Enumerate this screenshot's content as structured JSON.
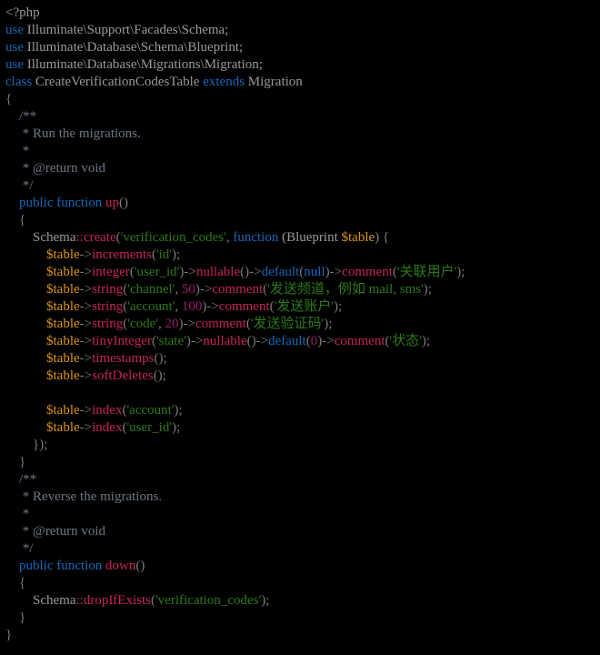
{
  "editor": {
    "title": "create_verification_codes_table.php",
    "language": "PHP",
    "background_color": "#000000",
    "font_size_px": 15,
    "line_height_px": 19
  },
  "theme": {
    "plain": "#9a9a9a",
    "keyword": "#1668b8",
    "type": "#9a9a9a",
    "method": "#c4245c",
    "string": "#2c7a18",
    "variable": "#e09512",
    "number": "#9b1a6e",
    "comment": "#6d7782",
    "punctuation": "#7a7a7a",
    "constant": "#1668b8"
  },
  "code": {
    "lines": [
      {
        "n": 1,
        "tokens": [
          {
            "t": "plain",
            "v": "<?php"
          }
        ]
      },
      {
        "n": 2,
        "tokens": [
          {
            "t": "keyword",
            "v": "use"
          },
          {
            "t": "plain",
            "v": " Illuminate\\Support\\Facades\\Schema;"
          }
        ]
      },
      {
        "n": 3,
        "tokens": [
          {
            "t": "keyword",
            "v": "use"
          },
          {
            "t": "plain",
            "v": " Illuminate\\Database\\Schema\\Blueprint;"
          }
        ]
      },
      {
        "n": 4,
        "tokens": [
          {
            "t": "keyword",
            "v": "use"
          },
          {
            "t": "plain",
            "v": " Illuminate\\Database\\Migrations\\Migration;"
          }
        ]
      },
      {
        "n": 5,
        "tokens": [
          {
            "t": "keyword",
            "v": "class"
          },
          {
            "t": "plain",
            "v": " CreateVerificationCodesTable "
          },
          {
            "t": "keyword",
            "v": "extends"
          },
          {
            "t": "plain",
            "v": " Migration"
          }
        ]
      },
      {
        "n": 6,
        "tokens": [
          {
            "t": "punct",
            "v": "{"
          }
        ]
      },
      {
        "n": 7,
        "tokens": [
          {
            "t": "comment",
            "v": "    /**"
          }
        ]
      },
      {
        "n": 8,
        "tokens": [
          {
            "t": "comment",
            "v": "     * Run the migrations."
          }
        ]
      },
      {
        "n": 9,
        "tokens": [
          {
            "t": "comment",
            "v": "     *"
          }
        ]
      },
      {
        "n": 10,
        "tokens": [
          {
            "t": "comment",
            "v": "     * @return void"
          }
        ]
      },
      {
        "n": 11,
        "tokens": [
          {
            "t": "comment",
            "v": "     */"
          }
        ]
      },
      {
        "n": 12,
        "tokens": [
          {
            "t": "plain",
            "v": "    "
          },
          {
            "t": "keyword",
            "v": "public function "
          },
          {
            "t": "method",
            "v": "up"
          },
          {
            "t": "punct",
            "v": "()"
          }
        ]
      },
      {
        "n": 13,
        "tokens": [
          {
            "t": "punct",
            "v": "    {"
          }
        ]
      },
      {
        "n": 14,
        "tokens": [
          {
            "t": "plain",
            "v": "        "
          },
          {
            "t": "type",
            "v": "Schema"
          },
          {
            "t": "method",
            "v": "::create"
          },
          {
            "t": "punct",
            "v": "("
          },
          {
            "t": "string",
            "v": "'verification_codes'"
          },
          {
            "t": "punct",
            "v": ", "
          },
          {
            "t": "keyword",
            "v": "function"
          },
          {
            "t": "plain",
            "v": " ("
          },
          {
            "t": "type",
            "v": "Blueprint "
          },
          {
            "t": "var",
            "v": "$table"
          },
          {
            "t": "punct",
            "v": ") {"
          }
        ]
      },
      {
        "n": 15,
        "tokens": [
          {
            "t": "plain",
            "v": "            "
          },
          {
            "t": "var",
            "v": "$table"
          },
          {
            "t": "punct",
            "v": "->"
          },
          {
            "t": "method",
            "v": "increments"
          },
          {
            "t": "punct",
            "v": "("
          },
          {
            "t": "string",
            "v": "'id'"
          },
          {
            "t": "punct",
            "v": ");"
          }
        ]
      },
      {
        "n": 16,
        "tokens": [
          {
            "t": "plain",
            "v": "            "
          },
          {
            "t": "var",
            "v": "$table"
          },
          {
            "t": "punct",
            "v": "->"
          },
          {
            "t": "method",
            "v": "integer"
          },
          {
            "t": "punct",
            "v": "("
          },
          {
            "t": "string",
            "v": "'user_id'"
          },
          {
            "t": "punct",
            "v": ")->"
          },
          {
            "t": "method",
            "v": "nullable"
          },
          {
            "t": "punct",
            "v": "()->"
          },
          {
            "t": "const",
            "v": "default"
          },
          {
            "t": "punct",
            "v": "("
          },
          {
            "t": "const",
            "v": "null"
          },
          {
            "t": "punct",
            "v": ")->"
          },
          {
            "t": "method",
            "v": "comment"
          },
          {
            "t": "punct",
            "v": "("
          },
          {
            "t": "string",
            "v": "'关联用户'"
          },
          {
            "t": "punct",
            "v": ");"
          }
        ]
      },
      {
        "n": 17,
        "tokens": [
          {
            "t": "plain",
            "v": "            "
          },
          {
            "t": "var",
            "v": "$table"
          },
          {
            "t": "punct",
            "v": "->"
          },
          {
            "t": "method",
            "v": "string"
          },
          {
            "t": "punct",
            "v": "("
          },
          {
            "t": "string",
            "v": "'channel'"
          },
          {
            "t": "punct",
            "v": ", "
          },
          {
            "t": "number",
            "v": "50"
          },
          {
            "t": "punct",
            "v": ")->"
          },
          {
            "t": "method",
            "v": "comment"
          },
          {
            "t": "punct",
            "v": "("
          },
          {
            "t": "string",
            "v": "'发送频道，例如 mail, sms'"
          },
          {
            "t": "punct",
            "v": ");"
          }
        ]
      },
      {
        "n": 18,
        "tokens": [
          {
            "t": "plain",
            "v": "            "
          },
          {
            "t": "var",
            "v": "$table"
          },
          {
            "t": "punct",
            "v": "->"
          },
          {
            "t": "method",
            "v": "string"
          },
          {
            "t": "punct",
            "v": "("
          },
          {
            "t": "string",
            "v": "'account'"
          },
          {
            "t": "punct",
            "v": ", "
          },
          {
            "t": "number",
            "v": "100"
          },
          {
            "t": "punct",
            "v": ")->"
          },
          {
            "t": "method",
            "v": "comment"
          },
          {
            "t": "punct",
            "v": "("
          },
          {
            "t": "string",
            "v": "'发送账户'"
          },
          {
            "t": "punct",
            "v": ");"
          }
        ]
      },
      {
        "n": 19,
        "tokens": [
          {
            "t": "plain",
            "v": "            "
          },
          {
            "t": "var",
            "v": "$table"
          },
          {
            "t": "punct",
            "v": "->"
          },
          {
            "t": "method",
            "v": "string"
          },
          {
            "t": "punct",
            "v": "("
          },
          {
            "t": "string",
            "v": "'code'"
          },
          {
            "t": "punct",
            "v": ", "
          },
          {
            "t": "number",
            "v": "20"
          },
          {
            "t": "punct",
            "v": ")->"
          },
          {
            "t": "method",
            "v": "comment"
          },
          {
            "t": "punct",
            "v": "("
          },
          {
            "t": "string",
            "v": "'发送验证码'"
          },
          {
            "t": "punct",
            "v": ");"
          }
        ]
      },
      {
        "n": 20,
        "tokens": [
          {
            "t": "plain",
            "v": "            "
          },
          {
            "t": "var",
            "v": "$table"
          },
          {
            "t": "punct",
            "v": "->"
          },
          {
            "t": "method",
            "v": "tinyInteger"
          },
          {
            "t": "punct",
            "v": "("
          },
          {
            "t": "string",
            "v": "'state'"
          },
          {
            "t": "punct",
            "v": ")->"
          },
          {
            "t": "method",
            "v": "nullable"
          },
          {
            "t": "punct",
            "v": "()->"
          },
          {
            "t": "const",
            "v": "default"
          },
          {
            "t": "punct",
            "v": "("
          },
          {
            "t": "number",
            "v": "0"
          },
          {
            "t": "punct",
            "v": ")->"
          },
          {
            "t": "method",
            "v": "comment"
          },
          {
            "t": "punct",
            "v": "("
          },
          {
            "t": "string",
            "v": "'状态'"
          },
          {
            "t": "punct",
            "v": ");"
          }
        ]
      },
      {
        "n": 21,
        "tokens": [
          {
            "t": "plain",
            "v": "            "
          },
          {
            "t": "var",
            "v": "$table"
          },
          {
            "t": "punct",
            "v": "->"
          },
          {
            "t": "method",
            "v": "timestamps"
          },
          {
            "t": "punct",
            "v": "();"
          }
        ]
      },
      {
        "n": 22,
        "tokens": [
          {
            "t": "plain",
            "v": "            "
          },
          {
            "t": "var",
            "v": "$table"
          },
          {
            "t": "punct",
            "v": "->"
          },
          {
            "t": "method",
            "v": "softDeletes"
          },
          {
            "t": "punct",
            "v": "();"
          }
        ]
      },
      {
        "n": 23,
        "tokens": [
          {
            "t": "plain",
            "v": ""
          }
        ]
      },
      {
        "n": 24,
        "tokens": [
          {
            "t": "plain",
            "v": "            "
          },
          {
            "t": "var",
            "v": "$table"
          },
          {
            "t": "punct",
            "v": "->"
          },
          {
            "t": "method",
            "v": "index"
          },
          {
            "t": "punct",
            "v": "("
          },
          {
            "t": "string",
            "v": "'account'"
          },
          {
            "t": "punct",
            "v": ");"
          }
        ]
      },
      {
        "n": 25,
        "tokens": [
          {
            "t": "plain",
            "v": "            "
          },
          {
            "t": "var",
            "v": "$table"
          },
          {
            "t": "punct",
            "v": "->"
          },
          {
            "t": "method",
            "v": "index"
          },
          {
            "t": "punct",
            "v": "("
          },
          {
            "t": "string",
            "v": "'user_id'"
          },
          {
            "t": "punct",
            "v": ");"
          }
        ]
      },
      {
        "n": 26,
        "tokens": [
          {
            "t": "punct",
            "v": "        });"
          }
        ]
      },
      {
        "n": 27,
        "tokens": [
          {
            "t": "punct",
            "v": "    }"
          }
        ]
      },
      {
        "n": 28,
        "tokens": [
          {
            "t": "comment",
            "v": "    /**"
          }
        ]
      },
      {
        "n": 29,
        "tokens": [
          {
            "t": "comment",
            "v": "     * Reverse the migrations."
          }
        ]
      },
      {
        "n": 30,
        "tokens": [
          {
            "t": "comment",
            "v": "     *"
          }
        ]
      },
      {
        "n": 31,
        "tokens": [
          {
            "t": "comment",
            "v": "     * @return void"
          }
        ]
      },
      {
        "n": 32,
        "tokens": [
          {
            "t": "comment",
            "v": "     */"
          }
        ]
      },
      {
        "n": 33,
        "tokens": [
          {
            "t": "plain",
            "v": "    "
          },
          {
            "t": "keyword",
            "v": "public function "
          },
          {
            "t": "method",
            "v": "down"
          },
          {
            "t": "punct",
            "v": "()"
          }
        ]
      },
      {
        "n": 34,
        "tokens": [
          {
            "t": "punct",
            "v": "    {"
          }
        ]
      },
      {
        "n": 35,
        "tokens": [
          {
            "t": "plain",
            "v": "        "
          },
          {
            "t": "type",
            "v": "Schema"
          },
          {
            "t": "method",
            "v": "::dropIfExists"
          },
          {
            "t": "punct",
            "v": "("
          },
          {
            "t": "string",
            "v": "'verification_codes'"
          },
          {
            "t": "punct",
            "v": ");"
          }
        ]
      },
      {
        "n": 36,
        "tokens": [
          {
            "t": "punct",
            "v": "    }"
          }
        ]
      },
      {
        "n": 37,
        "tokens": [
          {
            "t": "punct",
            "v": "}"
          }
        ]
      }
    ]
  }
}
